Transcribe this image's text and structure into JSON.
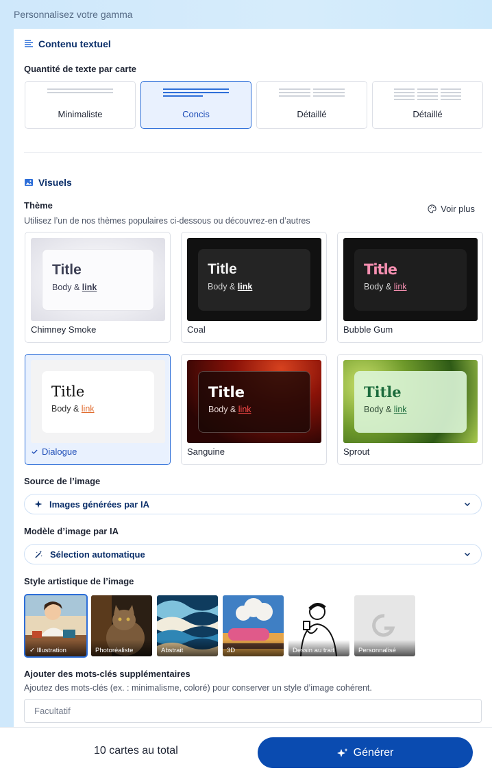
{
  "header": {
    "title": "Personnalisez votre gamma"
  },
  "text_section": {
    "title": "Contenu textuel",
    "label": "Quantité de texte par carte",
    "options": [
      {
        "label": "Minimaliste",
        "selected": false
      },
      {
        "label": "Concis",
        "selected": true
      },
      {
        "label": "Détaillé",
        "selected": false
      },
      {
        "label": "Détaillé",
        "selected": false
      }
    ]
  },
  "visuals": {
    "title": "Visuels",
    "theme_label": "Thème",
    "theme_sub": "Utilisez l’un de nos thèmes populaires ci-dessous ou découvrez-en d’autres",
    "voir_plus": "Voir plus",
    "theme_title_text": "Title",
    "theme_body_text": "Body & ",
    "theme_link_text": "link",
    "themes": [
      {
        "name": "Chimney Smoke",
        "selected": false
      },
      {
        "name": "Coal",
        "selected": false
      },
      {
        "name": "Bubble Gum",
        "selected": false
      },
      {
        "name": "Dialogue",
        "selected": true
      },
      {
        "name": "Sanguine",
        "selected": false
      },
      {
        "name": "Sprout",
        "selected": false
      }
    ]
  },
  "image_source": {
    "label": "Source de l’image",
    "value": "Images générées par IA",
    "icon": "sparkle-icon"
  },
  "image_model": {
    "label": "Modèle d’image par IA",
    "value": "Sélection automatique",
    "icon": "magic-wand-icon"
  },
  "art_style": {
    "label": "Style artistique de l’image",
    "styles": [
      {
        "label": "Illustration",
        "selected": true
      },
      {
        "label": "Photoréaliste",
        "selected": false
      },
      {
        "label": "Abstrait",
        "selected": false
      },
      {
        "label": "3D",
        "selected": false
      },
      {
        "label": "Dessin au trait",
        "selected": false
      },
      {
        "label": "Personnalisé",
        "selected": false
      }
    ]
  },
  "keywords": {
    "label": "Ajouter des mots-clés supplémentaires",
    "sub": "Ajoutez des mots-clés (ex. : minimalisme, coloré) pour conserver un style d’image cohérent.",
    "placeholder": "Facultatif"
  },
  "footer": {
    "total": "10 cartes au total",
    "generate": "Générer"
  },
  "colors": {
    "accent": "#2d6ed8",
    "primary_button": "#0a4bb0",
    "heading": "#0b2f6a"
  }
}
